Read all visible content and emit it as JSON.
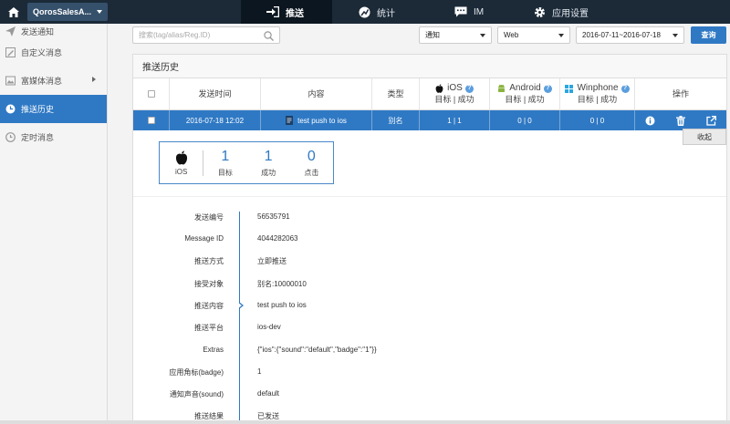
{
  "topbar": {
    "app_name": "QorosSalesA...",
    "tabs": [
      {
        "label": "推送",
        "icon": "push-icon"
      },
      {
        "label": "统计",
        "icon": "stats-icon"
      },
      {
        "label": "IM",
        "icon": "chat-icon"
      },
      {
        "label": "应用设置",
        "icon": "gear-icon"
      }
    ]
  },
  "sidebar": {
    "items": [
      {
        "label": "发送通知",
        "icon": "send-icon"
      },
      {
        "label": "自定义消息",
        "icon": "custom-message-icon"
      },
      {
        "label": "富媒体消息",
        "icon": "rich-media-icon"
      },
      {
        "label": "推送历史",
        "icon": "clock-icon"
      },
      {
        "label": "定时消息",
        "icon": "timer-icon"
      }
    ]
  },
  "filters": {
    "search_placeholder": "搜索(tag/alias/Reg.ID)",
    "type_value": "通知",
    "platform_value": "Web",
    "date_range": "2016-07-11~2016-07-18",
    "query_label": "查询"
  },
  "history": {
    "title": "推送历史",
    "columns": {
      "send_time": "发送时间",
      "content": "内容",
      "type": "类型",
      "ios": "iOS",
      "android": "Android",
      "winphone": "Winphone",
      "target_success": "目标 | 成功",
      "actions": "操作"
    },
    "row": {
      "send_time": "2016-07-18 12:02",
      "content": "test push to ios",
      "type": "别名",
      "ios": "1 | 1",
      "android": "0 | 0",
      "winphone": "0 | 0"
    },
    "collapse_label": "收起"
  },
  "summary": {
    "platform": "iOS",
    "target": {
      "value": "1",
      "label": "目标"
    },
    "success": {
      "value": "1",
      "label": "成功"
    },
    "clicks": {
      "value": "0",
      "label": "点击"
    }
  },
  "details": [
    {
      "label": "发送编号",
      "value": "56535791"
    },
    {
      "label": "Message ID",
      "value": "4044282063"
    },
    {
      "label": "推送方式",
      "value": "立即推送"
    },
    {
      "label": "接受对象",
      "value": "别名:10000010"
    },
    {
      "label": "推送内容",
      "value": "test push to ios"
    },
    {
      "label": "推送平台",
      "value": "ios-dev"
    },
    {
      "label": "Extras",
      "value": "{\"ios\":{\"sound\":\"default\",\"badge\":\"1\"}}"
    },
    {
      "label": "应用角标(badge)",
      "value": "1"
    },
    {
      "label": "通知声音(sound)",
      "value": "default"
    },
    {
      "label": "推送结果",
      "value": "已发送"
    }
  ],
  "colors": {
    "topbar": "#1c2a38",
    "accent": "#2f79c4",
    "android": "#8ab33f",
    "windows": "#2aa6e0"
  }
}
